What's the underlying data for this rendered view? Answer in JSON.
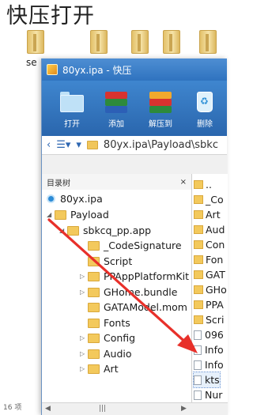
{
  "heading": "快压打开",
  "desktop": {
    "partial_label": "se"
  },
  "window": {
    "title": "80yx.ipa - 快压",
    "toolbar": [
      {
        "label": "打开",
        "icon": "open-folder-icon"
      },
      {
        "label": "添加",
        "icon": "add-books-icon"
      },
      {
        "label": "解压到",
        "icon": "extract-books-icon"
      },
      {
        "label": "删除",
        "icon": "recycle-bin-icon"
      }
    ],
    "address": {
      "path": "80yx.ipa\\Payload\\sbkc"
    },
    "tree": {
      "title": "目录树",
      "close": "×",
      "items": [
        {
          "label": "80yx.ipa"
        },
        {
          "label": "Payload"
        },
        {
          "label": "sbkcq_pp.app"
        },
        {
          "label": "_CodeSignature"
        },
        {
          "label": "Script"
        },
        {
          "label": "PPAppPlatformKit"
        },
        {
          "label": "GHome.bundle"
        },
        {
          "label": "GATAModel.mom"
        },
        {
          "label": "Fonts"
        },
        {
          "label": "Config"
        },
        {
          "label": "Audio"
        },
        {
          "label": "Art"
        }
      ]
    },
    "list": {
      "items": [
        {
          "label": ".."
        },
        {
          "label": "_Co"
        },
        {
          "label": "Art"
        },
        {
          "label": "Aud"
        },
        {
          "label": "Con"
        },
        {
          "label": "Fon"
        },
        {
          "label": "GAT"
        },
        {
          "label": "GHo"
        },
        {
          "label": "PPA"
        },
        {
          "label": "Scri"
        },
        {
          "label": "096"
        },
        {
          "label": "Info"
        },
        {
          "label": "Info"
        },
        {
          "label": "kts"
        },
        {
          "label": "Nur"
        },
        {
          "label": "Auc"
        }
      ]
    },
    "scrollbar": {
      "left": "◀",
      "thumb": "|||",
      "right": "▶"
    },
    "status_partial": "16 项"
  },
  "colors": {
    "title_bar": "#3a80cc",
    "arrow": "#e8302a"
  }
}
